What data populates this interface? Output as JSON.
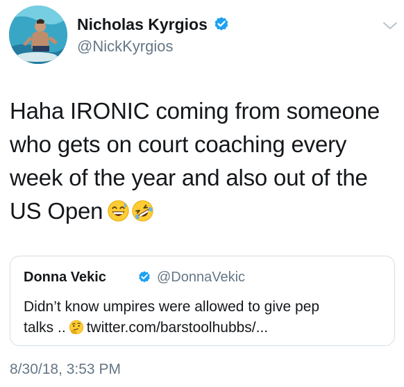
{
  "author": {
    "name": "Nicholas Kyrgios",
    "handle": "@NickKyrgios",
    "verified": true,
    "avatar_icon": "profile-avatar"
  },
  "menu_icon": "chevron-down-icon",
  "tweet": {
    "lines": [
      "Haha IRONIC coming from someone",
      "who gets on court coaching every",
      "week of the year and also out of the",
      "US Open"
    ],
    "emojis": [
      "grinning-sweat-emoji",
      "rolling-on-floor-laughing-emoji"
    ]
  },
  "quote": {
    "name": "Donna Vekic",
    "handle": "@DonnaVekic",
    "verified": true,
    "line1": "Didn’t know umpires were allowed to give pep",
    "line2_prefix": "talks ..",
    "emoji": "thinking-face-emoji",
    "link": "twitter.com/barstoolhubbs/..."
  },
  "timestamp": "8/30/18, 3:53 PM",
  "colors": {
    "text": "#14171a",
    "secondary": "#657786",
    "verified_blue": "#1da1f2",
    "border": "#d6dde3"
  }
}
